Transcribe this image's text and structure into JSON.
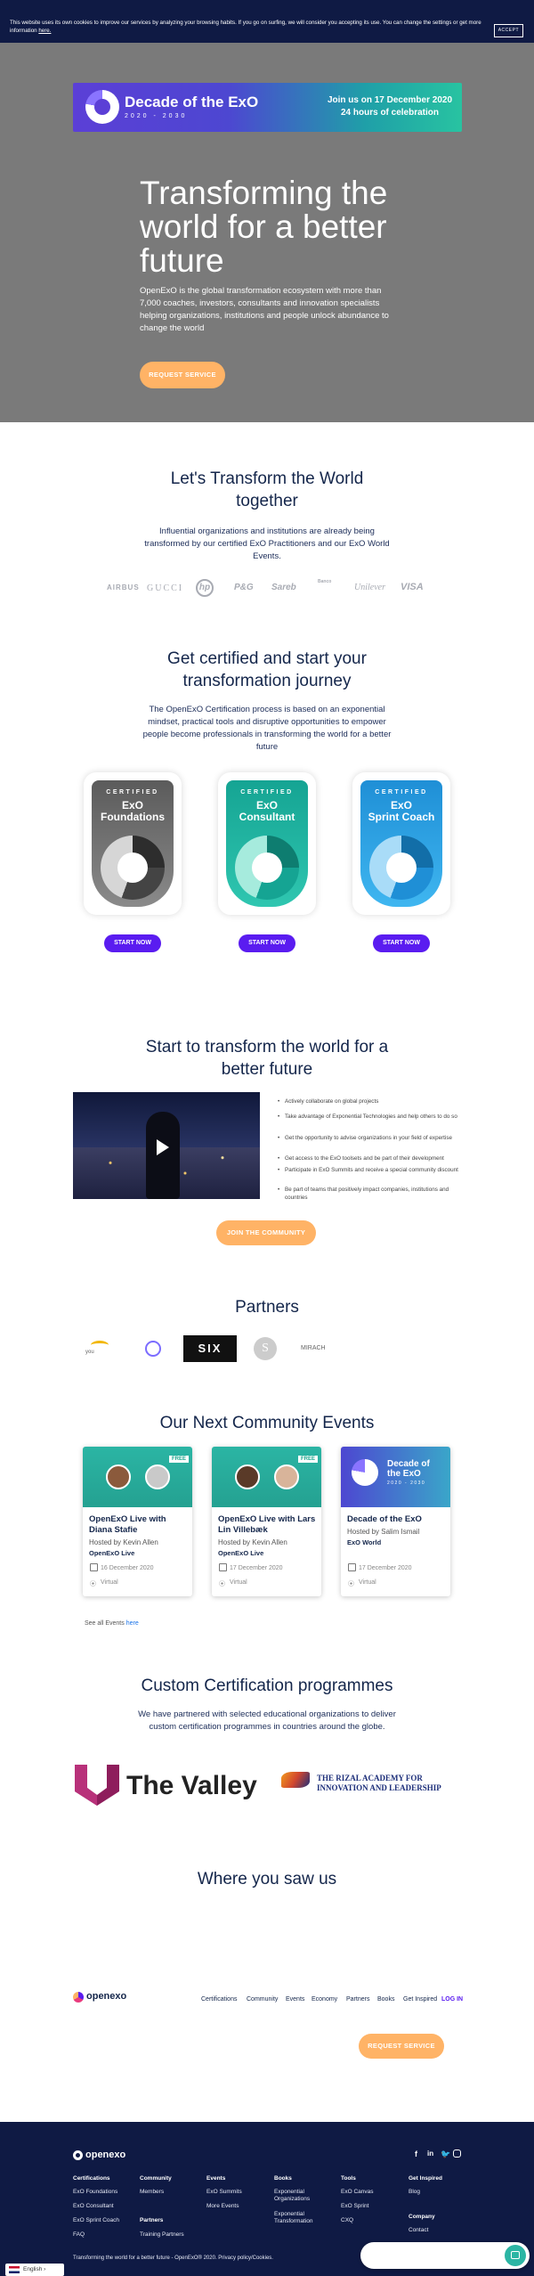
{
  "cookie": {
    "text": "This website uses its own cookies to improve our services by analyzing your browsing habits. If you go on surfing, we will consider you accepting its use. You can change the settings or get more information ",
    "link": "here.",
    "accept": "ACCEPT"
  },
  "banner": {
    "title": "Decade of the ExO",
    "years": "2020 - 2030",
    "join": "Join us on 17 December 2020",
    "hours": "24 hours of celebration"
  },
  "hero": {
    "title": "Transforming the world for a better future",
    "subtitle": "OpenExO is the global transformation ecosystem with more than 7,000 coaches, investors, consultants and innovation specialists helping organizations, institutions and people unlock abundance to change the world",
    "cta": "REQUEST SERVICE"
  },
  "transform": {
    "title_line1": "Let's Transform the World",
    "title_line2": "together",
    "text": "Influential organizations and institutions are already being transformed by our certified ExO Practitioners and our ExO World Events.",
    "logos": [
      "AIRBUS",
      "GUCCI",
      "hp",
      "P&G",
      "Sareb",
      "Banco",
      "Unilever",
      "VISA"
    ]
  },
  "certified": {
    "title_line1": "Get certified and start your",
    "title_line2": "transformation journey",
    "text": "The OpenExO Certification process is based on an exponential mindset, practical tools and disruptive opportunities to empower people become professionals in transforming the world for a better future",
    "badges": [
      {
        "cert": "CERTIFIED",
        "name1": "ExO",
        "name2": "Foundations",
        "button": "START NOW"
      },
      {
        "cert": "CERTIFIED",
        "name1": "ExO",
        "name2": "Consultant",
        "button": "START NOW"
      },
      {
        "cert": "CERTIFIED",
        "name1": "ExO",
        "name2": "Sprint Coach",
        "button": "START NOW"
      }
    ]
  },
  "community": {
    "title_line1": "Start to transform the world for a",
    "title_line2": "better future",
    "bullets": [
      "Actively collaborate on global projects",
      "Take advantage of Exponential Technologies and help others to do so",
      "Get the opportunity to advise organizations in your field of expertise",
      "Get access to the ExO toolsets and be part of their development",
      "Participate in ExO Summits and receive a special community discount",
      "Be part of teams that positively impact companies, institutions and countries"
    ],
    "cta": "JOIN THE COMMUNITY"
  },
  "partners": {
    "title": "Partners",
    "items": [
      "you",
      "SIX",
      "S",
      "MIRACH"
    ]
  },
  "events": {
    "title": "Our Next Community Events",
    "cards": [
      {
        "badge": "FREE",
        "title": "OpenExO Live with Diana Stafie",
        "host": "Hosted by Kevin Allen",
        "org": "OpenExO Live",
        "date": "16 December 2020",
        "location": "Virtual"
      },
      {
        "badge": "FREE",
        "title": "OpenExO Live with Lars Lin Villebæk",
        "host": "Hosted by Kevin Allen",
        "org": "OpenExO Live",
        "date": "17 December 2020",
        "location": "Virtual"
      },
      {
        "badge": "",
        "title": "Decade of the ExO",
        "host": "Hosted by Salim Ismail",
        "org": "ExO World",
        "date": "17 December 2020",
        "location": "Virtual",
        "img_title": "Decade of the ExO",
        "img_years": "2020 - 2030"
      }
    ],
    "see_all": "See all Events",
    "see_all_link": "here"
  },
  "custom": {
    "title": "Custom Certification programmes",
    "text": "We have partnered with selected educational organizations to deliver custom certification programmes in countries around the globe.",
    "valley": "The Valley",
    "rizal_line1": "THE RIZAL ACADEMY FOR",
    "rizal_line2": "INNOVATION AND LEADERSHIP"
  },
  "seen": {
    "title": "Where you saw us"
  },
  "nav": {
    "brand": "openexo",
    "links": [
      "Certifications",
      "Community",
      "Events",
      "Economy",
      "Partners",
      "Books",
      "Get Inspired"
    ],
    "login": "LOG IN",
    "cta": "REQUEST SERVICE"
  },
  "footer": {
    "brand": "openexo",
    "columns": [
      {
        "head": "Certifications",
        "items": [
          "ExO Foundations",
          "ExO Consultant",
          "ExO Sprint Coach",
          "FAQ"
        ]
      },
      {
        "head": "Community",
        "items": [
          "Members"
        ],
        "head2": "Partners",
        "items2": [
          "Training Partners"
        ]
      },
      {
        "head": "Events",
        "items": [
          "ExO Summits",
          "More Events"
        ]
      },
      {
        "head": "Books",
        "items": [
          "Exponential Organizations",
          "Exponential Transformation"
        ]
      },
      {
        "head": "Tools",
        "items": [
          "ExO Canvas",
          "ExO Sprint",
          "CXQ"
        ]
      },
      {
        "head": "Get Inspired",
        "items": [
          "Blog"
        ],
        "head2": "Company",
        "items2": [
          "Contact"
        ]
      }
    ],
    "bottom": "Transforming the world for a better future - OpenExO® 2020. Privacy policy/Cookies.",
    "lang": "English"
  },
  "colors": {
    "navy": "#0f1a44",
    "orange": "#ffb366",
    "purple": "#5a1cf0",
    "teal": "#2bb5a4"
  }
}
